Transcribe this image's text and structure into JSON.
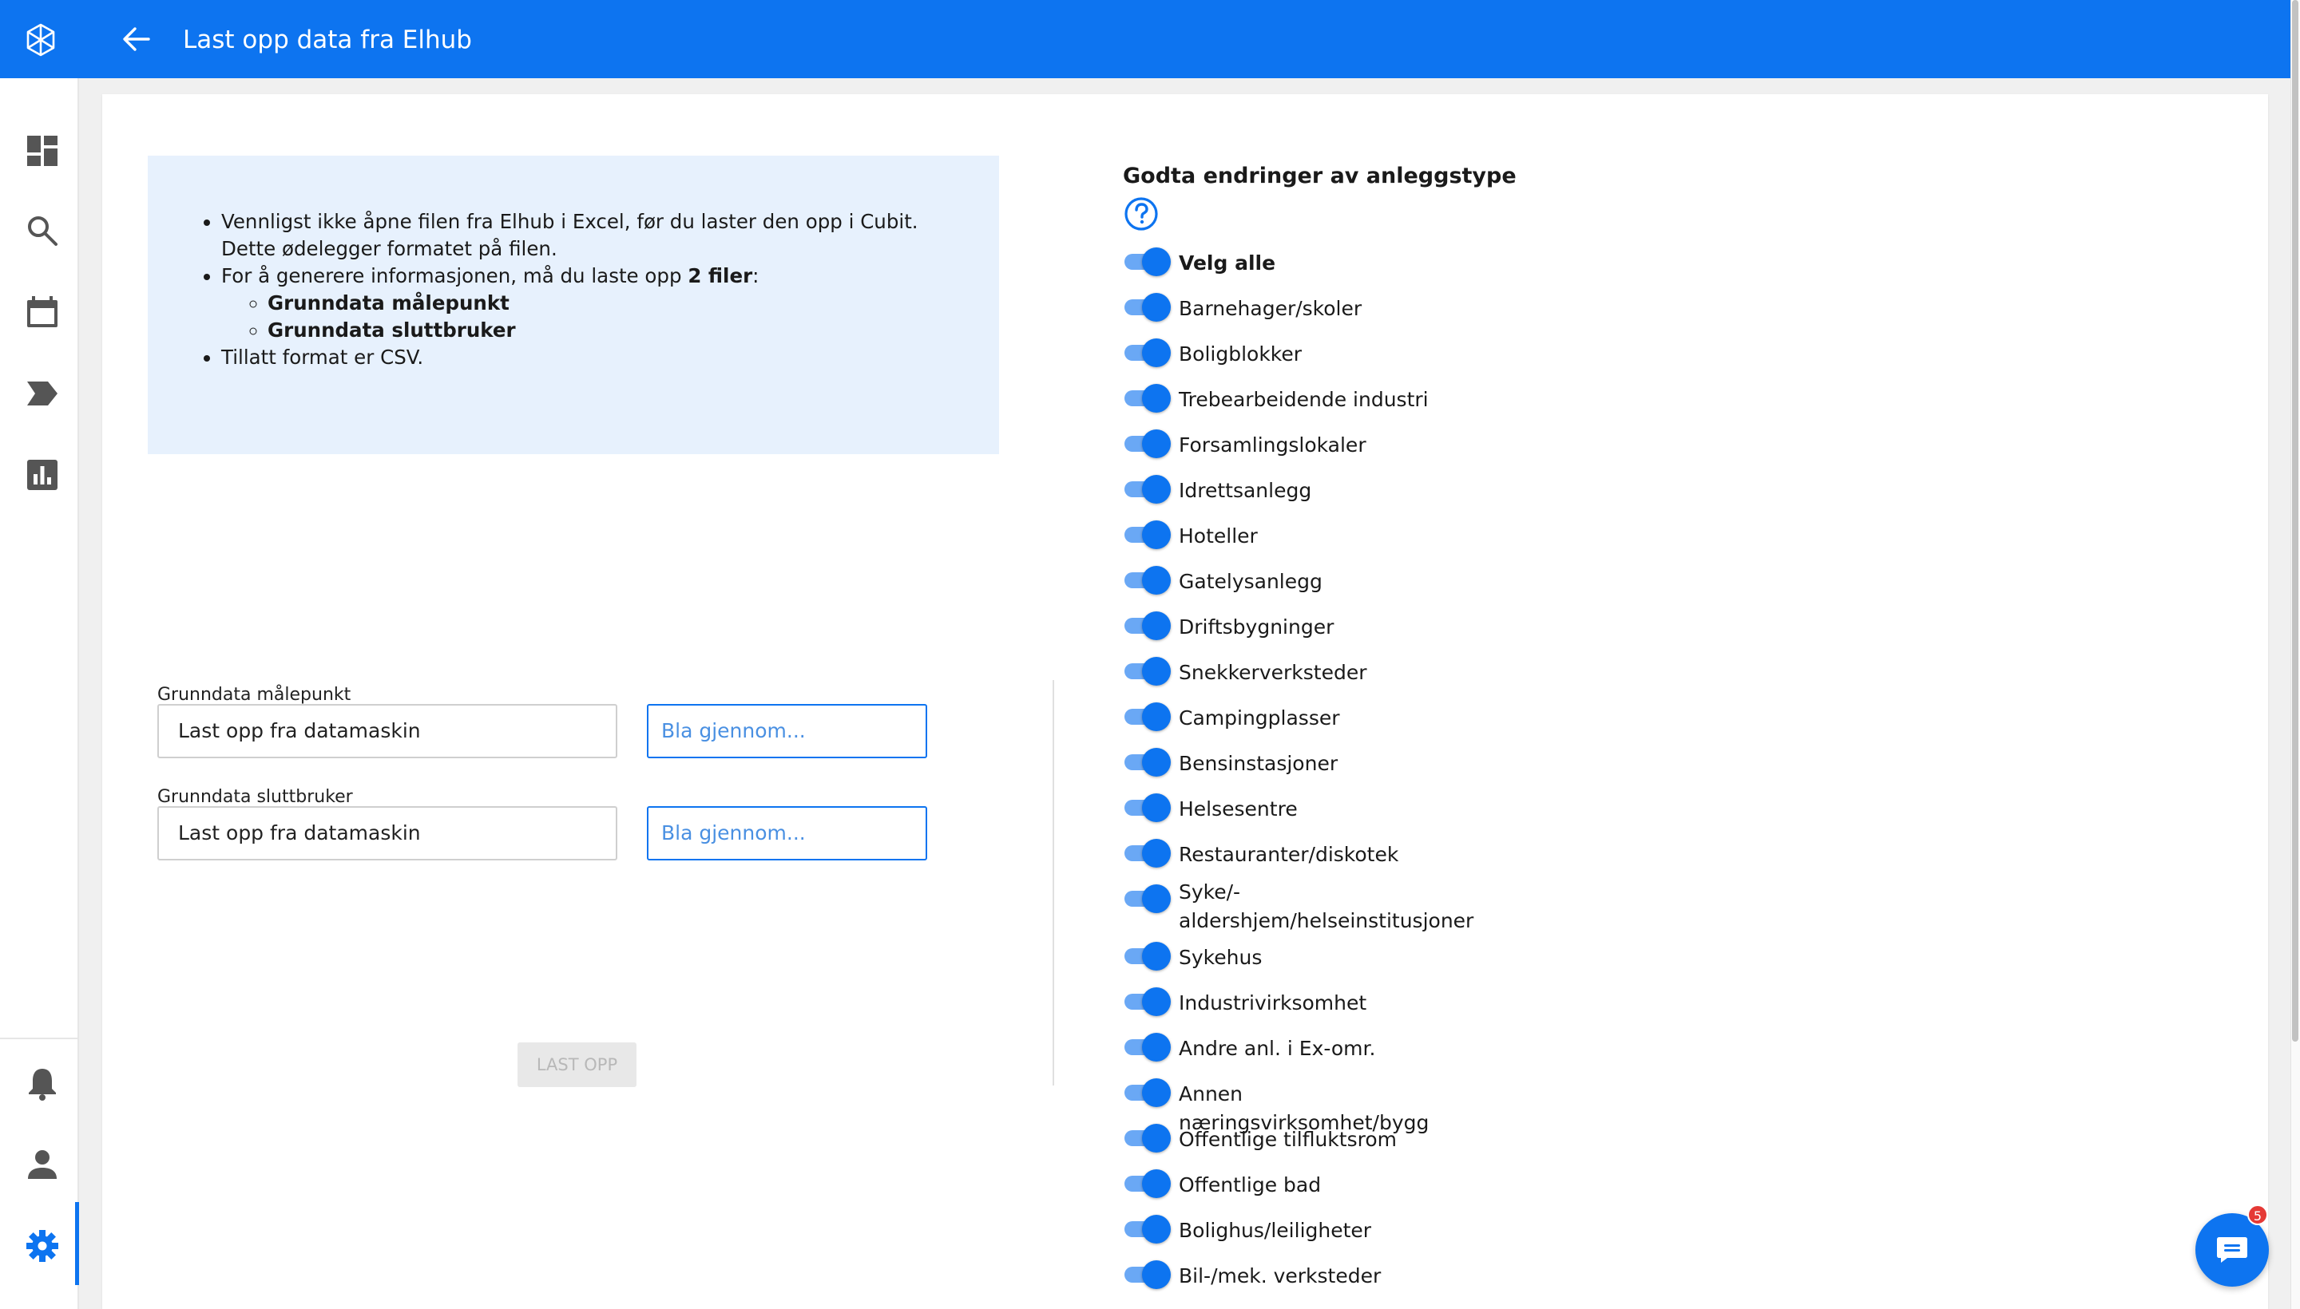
{
  "header": {
    "title": "Last opp data fra Elhub",
    "logo_icon": "cubit-logo-icon",
    "back_icon": "arrow-back-icon",
    "color": "#0d74f0"
  },
  "sidebar": {
    "items": [
      {
        "name": "dashboard",
        "icon": "dashboard-icon"
      },
      {
        "name": "search",
        "icon": "search-icon"
      },
      {
        "name": "calendar",
        "icon": "calendar-icon"
      },
      {
        "name": "tag",
        "icon": "tag-icon"
      },
      {
        "name": "reports",
        "icon": "bar-chart-icon"
      },
      {
        "name": "notifications",
        "icon": "bell-icon"
      },
      {
        "name": "profile",
        "icon": "person-icon"
      },
      {
        "name": "settings",
        "icon": "gear-icon",
        "active": true
      }
    ]
  },
  "info": {
    "bullet1": "Vennligst ikke åpne filen fra Elhub i Excel, før du laster den opp i Cubit. Dette ødelegger formatet på filen.",
    "bullet2_prefix": "For å generere informasjonen, må du laste opp ",
    "bullet2_bold": "2 filer",
    "bullet2_suffix": ":",
    "sub1": "Grunndata målepunkt",
    "sub2": "Grunndata sluttbruker",
    "bullet3": "Tillatt format er CSV."
  },
  "uploads": [
    {
      "label": "Grunndata målepunkt",
      "value": "Last opp fra datamaskin",
      "browse": "Bla gjennom..."
    },
    {
      "label": "Grunndata sluttbruker",
      "value": "Last opp fra datamaskin",
      "browse": "Bla gjennom..."
    }
  ],
  "upload_button": "LAST OPP",
  "approvals": {
    "title": "Godta endringer av anleggstype",
    "help_icon": "help-circle-icon",
    "select_all": "Velg alle",
    "items": [
      "Barnehager/skoler",
      "Boligblokker",
      "Trebearbeidende industri",
      "Forsamlingslokaler",
      "Idrettsanlegg",
      "Hoteller",
      "Gatelysanlegg",
      "Driftsbygninger",
      "Snekkerverksteder",
      "Campingplasser",
      "Bensinstasjoner",
      "Helsesentre",
      "Restauranter/diskotek",
      "Syke/-aldershjem/helseinstitusjoner",
      "Sykehus",
      "Industrivirksomhet",
      "Andre anl. i Ex-omr.",
      "Annen næringsvirksomhet/bygg",
      "Offentlige tilfluktsrom",
      "Offentlige bad",
      "Bolighus/leiligheter",
      "Bil-/mek. verksteder"
    ]
  },
  "chat": {
    "icon": "chat-icon",
    "badge": "5"
  }
}
